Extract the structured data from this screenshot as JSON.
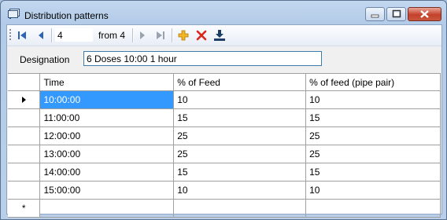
{
  "window": {
    "title": "Distribution patterns"
  },
  "navigator": {
    "position": "4",
    "of_label": "from 4"
  },
  "designation": {
    "label": "Designation",
    "value": "6 Doses 10:00 1 hour"
  },
  "grid": {
    "columns": [
      "Time",
      "% of Feed",
      "% of feed (pipe pair)"
    ],
    "rows": [
      {
        "time": "10:00:00",
        "feed": "10",
        "pipe": "10"
      },
      {
        "time": "11:00:00",
        "feed": "15",
        "pipe": "15"
      },
      {
        "time": "12:00:00",
        "feed": "25",
        "pipe": "25"
      },
      {
        "time": "13:00:00",
        "feed": "25",
        "pipe": "25"
      },
      {
        "time": "14:00:00",
        "feed": "15",
        "pipe": "15"
      },
      {
        "time": "15:00:00",
        "feed": "10",
        "pipe": "10"
      }
    ],
    "new_row_marker": "*"
  },
  "colors": {
    "selection": "#3399ff",
    "titlebar": "#b9cfe9",
    "close": "#c4412a"
  }
}
